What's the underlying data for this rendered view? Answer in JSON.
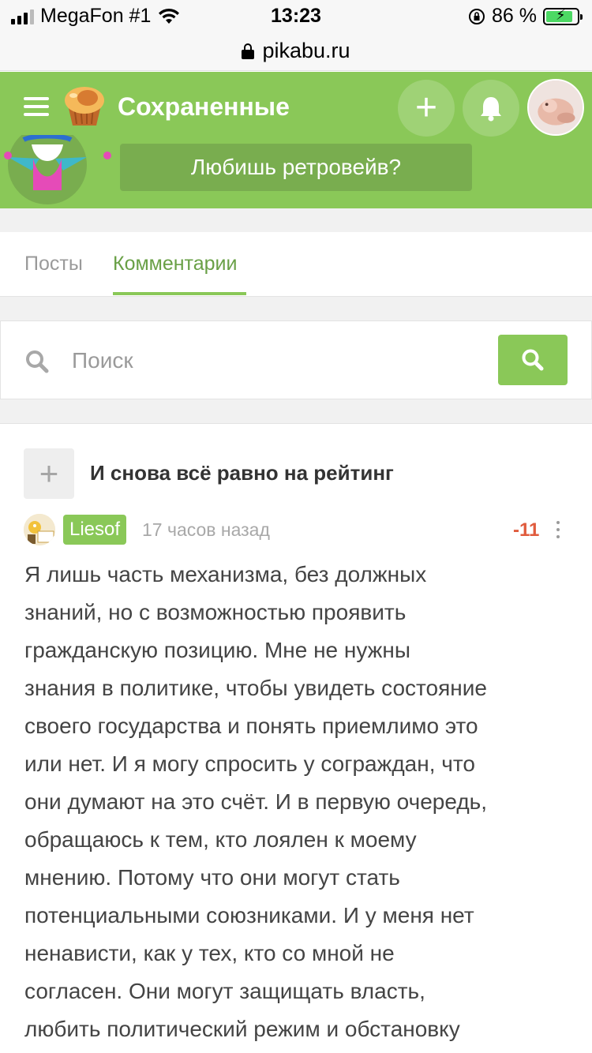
{
  "status_bar": {
    "carrier": "MegaFon #1",
    "time": "13:23",
    "battery": "86 %"
  },
  "url_bar": {
    "url": "pikabu.ru"
  },
  "header": {
    "title": "Сохраненные",
    "banner_text": "Любишь ретровейв?",
    "accent_color": "#8ac858"
  },
  "tabs": [
    {
      "label": "Посты",
      "active": false
    },
    {
      "label": "Комментарии",
      "active": true
    }
  ],
  "search": {
    "placeholder": "Поиск",
    "value": ""
  },
  "post": {
    "title": "И снова всё равно на рейтинг"
  },
  "comment": {
    "author": "Liesof",
    "time": "17 часов назад",
    "rating": "-11",
    "lines": [
      "Я лишь часть механизма, без должных",
      "знаний, но с возможностью проявить",
      "гражданскую позицию. Мне не нужны",
      "знания в политике, чтобы увидеть состояние",
      "своего государства и понять приемлимо это",
      "или нет. И я могу спросить у сограждан, что",
      "они думают на это счёт. И в первую очередь,",
      "обращаюсь к тем, кто лоялен к моему",
      "мнению. Потому что они могут стать",
      "потенциальными союзниками. И у меня нет",
      "ненависти, как у тех, кто со мной не",
      "согласен. Они могут защищать власть,",
      "любить политический режим и обстановку"
    ]
  },
  "icons": {
    "menu": "hamburger-icon",
    "add": "plus-icon",
    "notifications": "bell-icon",
    "search": "search-icon",
    "more": "more-vertical-icon"
  }
}
